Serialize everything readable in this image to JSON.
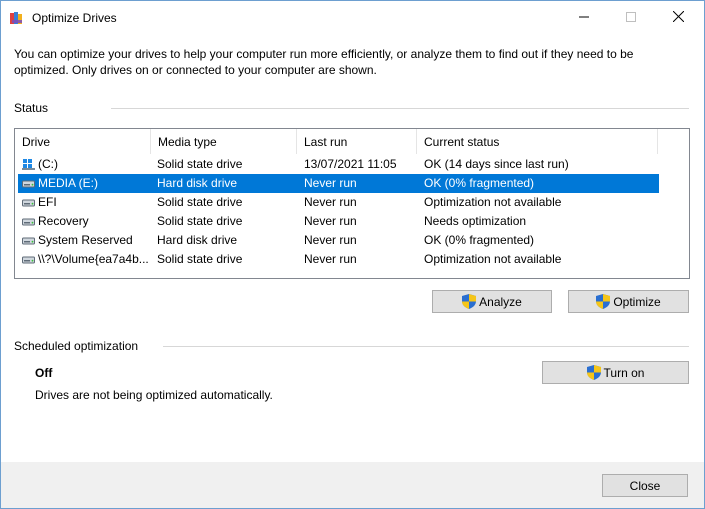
{
  "window": {
    "title": "Optimize Drives",
    "icons": {
      "app": "defrag-icon",
      "minimize": "minimize-icon",
      "maximize": "maximize-icon",
      "close": "close-icon"
    }
  },
  "description": "You can optimize your drives to help your computer run more efficiently, or analyze them to find out if they need to be optimized. Only drives on or connected to your computer are shown.",
  "status": {
    "label": "Status",
    "columns": [
      "Drive",
      "Media type",
      "Last run",
      "Current status"
    ],
    "drives": [
      {
        "name": "(C:)",
        "media": "Solid state drive",
        "last_run": "13/07/2021 11:05",
        "status": "OK (14 days since last run)",
        "icon": "windows-drive-icon",
        "selected": false
      },
      {
        "name": "MEDIA (E:)",
        "media": "Hard disk drive",
        "last_run": "Never run",
        "status": "OK (0% fragmented)",
        "icon": "drive-icon",
        "selected": true
      },
      {
        "name": "EFI",
        "media": "Solid state drive",
        "last_run": "Never run",
        "status": "Optimization not available",
        "icon": "drive-icon",
        "selected": false
      },
      {
        "name": "Recovery",
        "media": "Solid state drive",
        "last_run": "Never run",
        "status": "Needs optimization",
        "icon": "drive-icon",
        "selected": false
      },
      {
        "name": "System Reserved",
        "media": "Hard disk drive",
        "last_run": "Never run",
        "status": "OK (0% fragmented)",
        "icon": "drive-icon",
        "selected": false
      },
      {
        "name": "\\\\?\\Volume{ea7a4b...",
        "media": "Solid state drive",
        "last_run": "Never run",
        "status": "Optimization not available",
        "icon": "drive-icon",
        "selected": false
      }
    ],
    "analyze_label": "Analyze",
    "optimize_label": "Optimize"
  },
  "schedule": {
    "label": "Scheduled optimization",
    "state": "Off",
    "description": "Drives are not being optimized automatically.",
    "turn_on_label": "Turn on"
  },
  "close_label": "Close",
  "colors": {
    "selection": "#0078d7",
    "button": "#e1e1e1",
    "footer": "#f0f0f0",
    "border": "#6d9fd0"
  }
}
